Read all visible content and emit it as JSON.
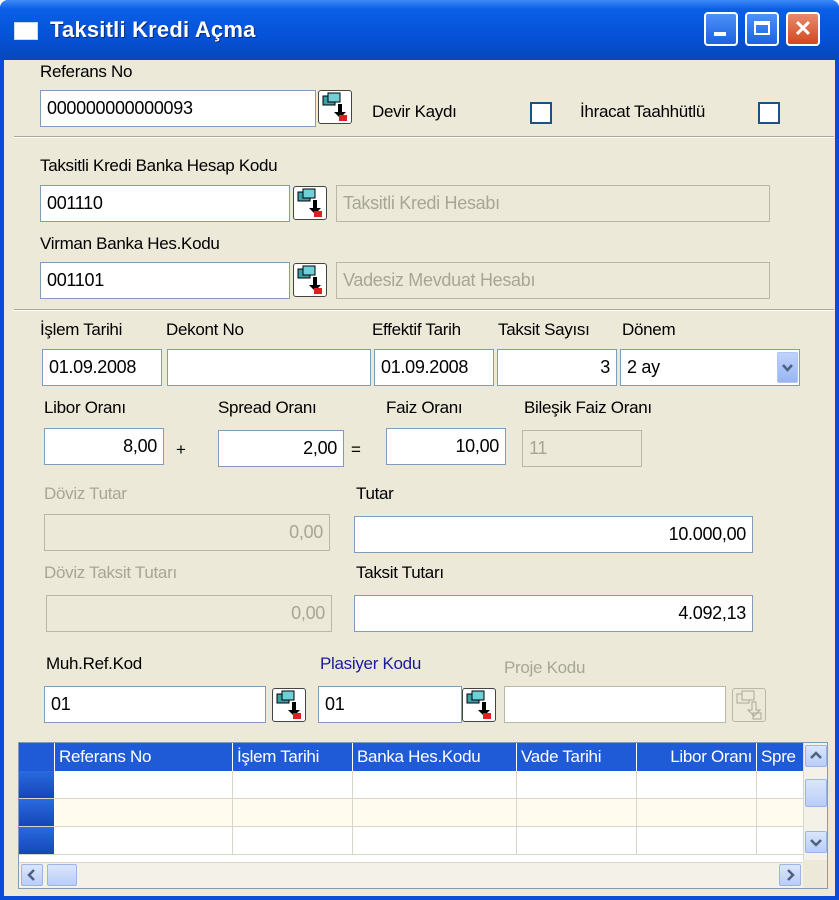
{
  "window": {
    "title": "Taksitli Kredi Açma",
    "close_glyph": "✕"
  },
  "referans": {
    "label": "Referans No",
    "value": "000000000000093"
  },
  "devir": {
    "label": "Devir Kaydı",
    "checked": false
  },
  "ihracat": {
    "label": "İhracat Taahhütlü",
    "checked": false
  },
  "banka_hesap": {
    "label": "Taksitli Kredi Banka Hesap Kodu",
    "value": "001110",
    "description": "Taksitli Kredi Hesabı"
  },
  "virman": {
    "label": "Virman Banka Hes.Kodu",
    "value": "001101",
    "description": "Vadesiz Mevduat Hesabı"
  },
  "islem_tarihi": {
    "label": "İşlem Tarihi",
    "value": "01.09.2008"
  },
  "dekont_no": {
    "label": "Dekont No",
    "value": ""
  },
  "effektif_tarih": {
    "label": "Effektif Tarih",
    "value": "01.09.2008"
  },
  "taksit_sayisi": {
    "label": "Taksit Sayısı",
    "value": "3"
  },
  "donem": {
    "label": "Dönem",
    "value": "2 ay"
  },
  "libor": {
    "label": "Libor Oranı",
    "value": "8,00"
  },
  "spread": {
    "label": "Spread Oranı",
    "value": "2,00"
  },
  "faiz": {
    "label": "Faiz Oranı",
    "value": "10,00"
  },
  "bilesik": {
    "label": "Bileşik Faiz Oranı",
    "value": "11"
  },
  "ops": {
    "plus": "+",
    "equals": "="
  },
  "doviz_tutar": {
    "label": "Döviz Tutar",
    "value": "0,00"
  },
  "tutar": {
    "label": "Tutar",
    "value": "10.000,00"
  },
  "doviz_taksit": {
    "label": "Döviz Taksit Tutarı",
    "value": "0,00"
  },
  "taksit_tutari": {
    "label": "Taksit Tutarı",
    "value": "4.092,13"
  },
  "muh_ref": {
    "label": "Muh.Ref.Kod",
    "value": "01"
  },
  "plasiyer": {
    "label": "Plasiyer Kodu",
    "value": "01"
  },
  "proje": {
    "label": "Proje Kodu",
    "value": ""
  },
  "grid": {
    "columns": [
      "Referans No",
      "İşlem Tarihi",
      "Banka Hes.Kodu",
      "Vade Tarihi",
      "Libor Oranı",
      "Spre"
    ],
    "rows": [
      {},
      {},
      {}
    ]
  },
  "icons": {
    "title": "window-app-icon",
    "picker": "lookup-picker-icon",
    "dropdown": "chevron-down-icon"
  },
  "colors": {
    "titlebar": "#0552d8",
    "window_bg": "#ece9d8",
    "grid_header": "#1f5bd6",
    "field_border": "#7f9db9"
  }
}
